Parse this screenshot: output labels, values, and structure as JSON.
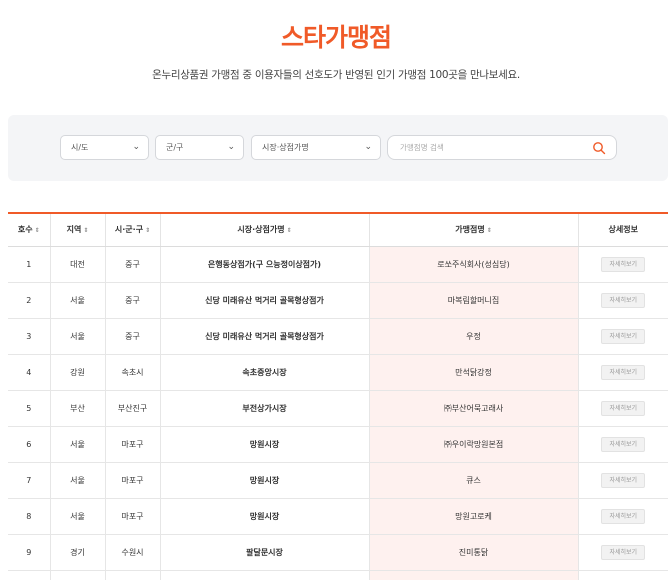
{
  "header": {
    "title": "스타가맹점",
    "subtitle": "온누리상품권 가맹점 중 이용자들의 선호도가 반영된 인기 가맹점 100곳을 만나보세요."
  },
  "filters": {
    "region": "시/도",
    "district": "군/구",
    "market": "시장·상점가명",
    "search_placeholder": "가맹점명 검색"
  },
  "table": {
    "columns": [
      "호수",
      "지역",
      "시·군·구",
      "시장·상점가명",
      "가맹점명",
      "상세정보"
    ],
    "detail_label": "자세히보기",
    "rows": [
      {
        "no": "1",
        "region": "대전",
        "district": "중구",
        "market": "은행동상점가(구 으능정이상점가)",
        "store": "로쏘주식회사(성심당)"
      },
      {
        "no": "2",
        "region": "서울",
        "district": "중구",
        "market": "신당 미래유산 먹거리 골목형상점가",
        "store": "마복림할머니집"
      },
      {
        "no": "3",
        "region": "서울",
        "district": "중구",
        "market": "신당 미래유산 먹거리 골목형상점가",
        "store": "우정"
      },
      {
        "no": "4",
        "region": "강원",
        "district": "속초시",
        "market": "속초중앙시장",
        "store": "만석닭강정"
      },
      {
        "no": "5",
        "region": "부산",
        "district": "부산진구",
        "market": "부전상가시장",
        "store": "㈜부산어묵고래사"
      },
      {
        "no": "6",
        "region": "서울",
        "district": "마포구",
        "market": "망원시장",
        "store": "㈜우이락망원본점"
      },
      {
        "no": "7",
        "region": "서울",
        "district": "마포구",
        "market": "망원시장",
        "store": "큐스"
      },
      {
        "no": "8",
        "region": "서울",
        "district": "마포구",
        "market": "망원시장",
        "store": "망원고로케"
      },
      {
        "no": "9",
        "region": "경기",
        "district": "수원시",
        "market": "팔달문시장",
        "store": "진미통닭"
      },
      {
        "no": "",
        "region": "",
        "district": "",
        "market": "",
        "store": ""
      }
    ]
  },
  "colors": {
    "accent": "#f05a28",
    "store_bg": "#fef1ef"
  }
}
